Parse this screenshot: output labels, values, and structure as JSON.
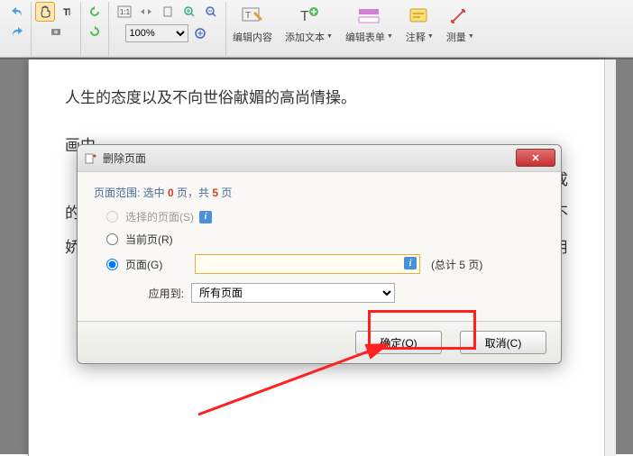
{
  "toolbar": {
    "zoom_value": "100%",
    "groups": {
      "edit_content": "编辑内容",
      "add_text": "添加文本",
      "edit_form": "编辑表单",
      "annotate": "注释",
      "measure": "测量"
    }
  },
  "document": {
    "line1": "人生的态度以及不向世俗献媚的高尚情操。",
    "line2_prefix": "画中",
    "line2_suffix": "成",
    "line3_prefix": "的。",
    "line3_suffix": "不",
    "line4_prefix": "娇艳",
    "line4_suffix": "用",
    "line2_end": "。"
  },
  "dialog": {
    "title": "删除页面",
    "range_prefix": "页面范围: 选中 ",
    "range_sel": "0",
    "range_mid": " 页，共 ",
    "range_total": "5",
    "range_suffix": " 页",
    "radio_selected": "选择的页面(S)",
    "radio_current": "当前页(R)",
    "radio_pages": "页面(G)",
    "page_input_value": "",
    "total_label": "(总计 5 页)",
    "apply_label": "应用到:",
    "apply_value": "所有页面",
    "ok": "确定(O)",
    "cancel": "取消(C)"
  }
}
